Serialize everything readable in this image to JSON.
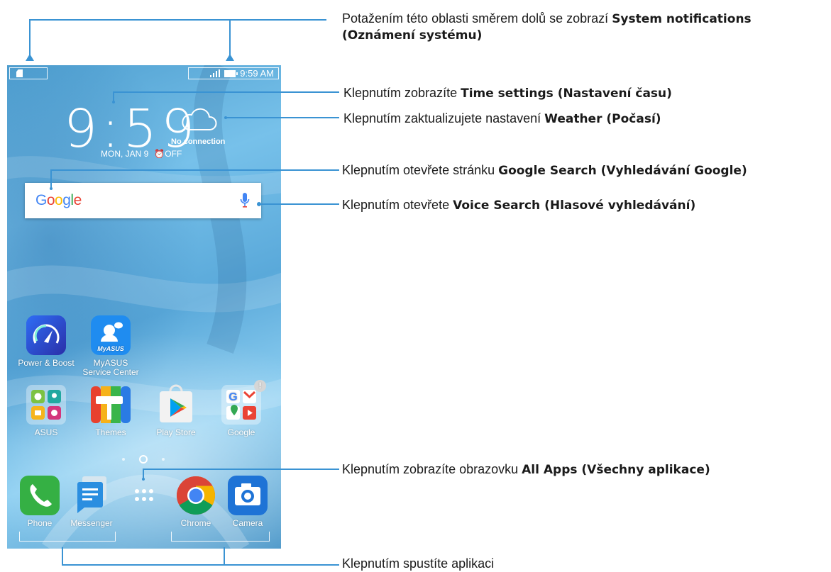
{
  "status_bar": {
    "time": "9:59 AM"
  },
  "clock": {
    "time": "9:59",
    "date": "MON, JAN 9",
    "alarm": "⏰OFF"
  },
  "weather": {
    "status": "No connection"
  },
  "search": {
    "logo": "Google"
  },
  "apps": {
    "row1": [
      {
        "label": "Power & Boost",
        "icon": "power-boost-icon"
      },
      {
        "label": "MyASUS Service Center",
        "icon": "myasus-icon"
      }
    ],
    "row2": [
      {
        "label": "ASUS",
        "icon": "asus-folder-icon"
      },
      {
        "label": "Themes",
        "icon": "themes-icon"
      },
      {
        "label": "Play Store",
        "icon": "play-store-icon"
      },
      {
        "label": "Google",
        "icon": "google-folder-icon"
      }
    ],
    "dock": [
      {
        "label": "Phone",
        "icon": "phone-icon"
      },
      {
        "label": "Messenger",
        "icon": "messenger-icon"
      },
      {
        "label": "",
        "icon": "all-apps-icon"
      },
      {
        "label": "Chrome",
        "icon": "chrome-icon"
      },
      {
        "label": "Camera",
        "icon": "camera-icon"
      }
    ]
  },
  "callouts": {
    "notifications": {
      "prefix": "Potažením této oblasti směrem dolů se zobrazí ",
      "bold": "System notifications",
      "bold2": "(Oznámení systému)"
    },
    "time_settings": {
      "prefix": "Klepnutím zobrazíte ",
      "bold": "Time settings (Nastavení času)"
    },
    "weather": {
      "prefix": "Klepnutím zaktualizujete nastavení ",
      "bold": "Weather (Počasí)"
    },
    "google_search": {
      "prefix": "Klepnutím otevřete stránku ",
      "bold": "Google Search (Vyhledávání Google)"
    },
    "voice_search": {
      "prefix": "Klepnutím otevřete ",
      "bold": "Voice Search (Hlasové vyhledávání)"
    },
    "all_apps": {
      "prefix": "Klepnutím zobrazíte obrazovku ",
      "bold": "All Apps (Všechny aplikace)"
    },
    "launch_app": {
      "text": "Klepnutím spustíte aplikaci"
    }
  },
  "colors": {
    "callout_line": "#3a93d3",
    "text": "#1a1a1a"
  }
}
